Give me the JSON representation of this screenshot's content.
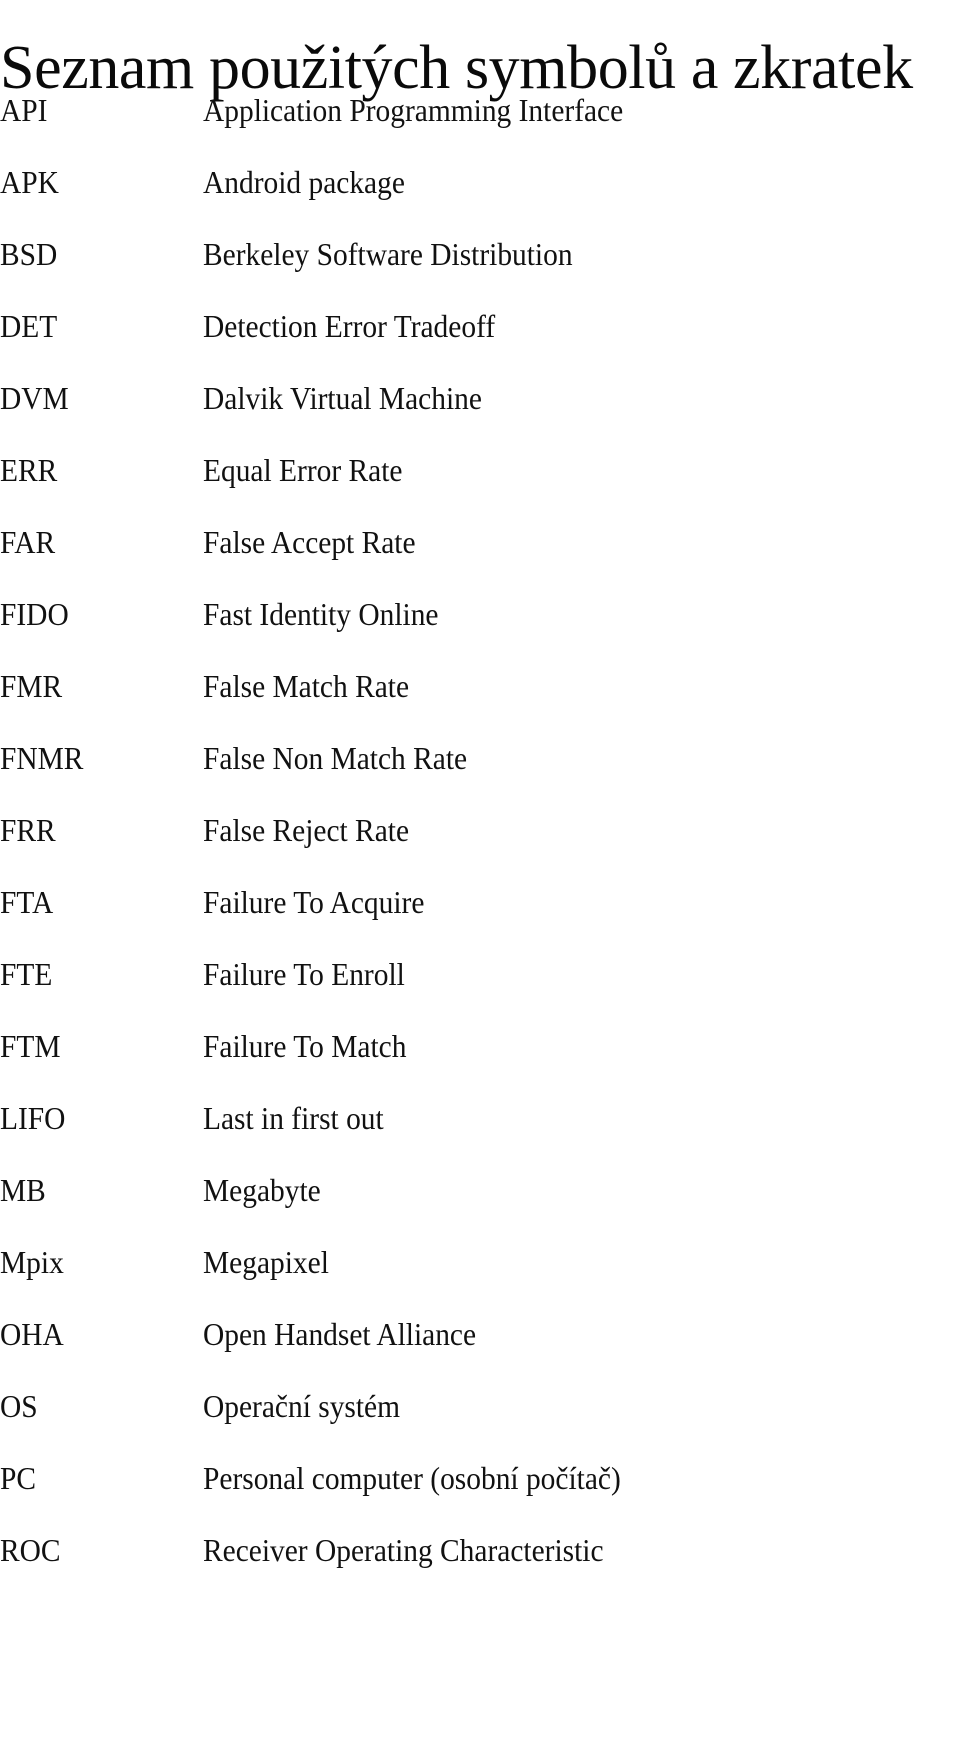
{
  "document": {
    "title": "Seznam použitých symbolů a zkratek",
    "language": "cs",
    "page_background": "#ffffff",
    "text_color": "#111111"
  },
  "glossary": {
    "entries": [
      {
        "abbr": "API",
        "definition": "Application Programming Interface"
      },
      {
        "abbr": "APK",
        "definition": "Android package"
      },
      {
        "abbr": "BSD",
        "definition": "Berkeley Software Distribution"
      },
      {
        "abbr": "DET",
        "definition": "Detection Error Tradeoff"
      },
      {
        "abbr": "DVM",
        "definition": "Dalvik Virtual Machine"
      },
      {
        "abbr": "ERR",
        "definition": "Equal Error Rate"
      },
      {
        "abbr": "FAR",
        "definition": "False Accept Rate"
      },
      {
        "abbr": "FIDO",
        "definition": "Fast Identity Online"
      },
      {
        "abbr": "FMR",
        "definition": "False Match Rate"
      },
      {
        "abbr": "FNMR",
        "definition": "False Non Match Rate"
      },
      {
        "abbr": "FRR",
        "definition": "False Reject Rate"
      },
      {
        "abbr": "FTA",
        "definition": "Failure To Acquire"
      },
      {
        "abbr": "FTE",
        "definition": "Failure To Enroll"
      },
      {
        "abbr": "FTM",
        "definition": "Failure To Match"
      },
      {
        "abbr": "LIFO",
        "definition": "Last in first out"
      },
      {
        "abbr": "MB",
        "definition": "Megabyte"
      },
      {
        "abbr": "Mpix",
        "definition": "Megapixel"
      },
      {
        "abbr": "OHA",
        "definition": "Open Handset Alliance"
      },
      {
        "abbr": "OS",
        "definition": "Operační systém"
      },
      {
        "abbr": "PC",
        "definition": "Personal computer (osobní počítač)"
      },
      {
        "abbr": "ROC",
        "definition": "Receiver Operating Characteristic"
      }
    ]
  }
}
